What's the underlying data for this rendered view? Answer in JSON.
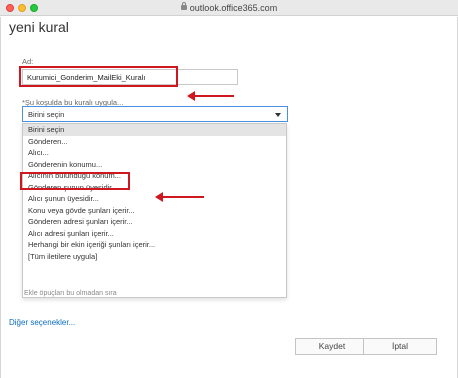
{
  "browser": {
    "url": "outlook.office365.com"
  },
  "dialog": {
    "title": "yeni kural",
    "name_label": "Ad:",
    "name_value": "Kurumici_Gonderim_MailEki_Kuralı",
    "condition_label": "*Şu koşulda bu kuralı uygula...",
    "condition_selected": "Birini seçin",
    "dropdown_options": [
      "Birini seçin",
      "Gönderen...",
      "Alıcı...",
      "Gönderenin konumu...",
      "Alıcının bulunduğu konum...",
      "Gönderen şunun üyesidir...",
      "Alıcı şunun üyesidir...",
      "Konu veya gövde şunları içerir...",
      "Gönderen adresi şunları içerir...",
      "Alıcı adresi şunları içerir...",
      "Herhangi bir ekin içeriği şunları içerir...",
      "[Tüm iletilere uygula]"
    ],
    "obscured_text": "Ekle öpuçları bu olmadan sıra",
    "more_options": "Diğer seçenekler...",
    "save_button": "Kaydet",
    "cancel_button": "İptal"
  },
  "colors": {
    "highlight": "#d0161e",
    "link": "#0b6cc1",
    "focus": "#4a90e2"
  }
}
